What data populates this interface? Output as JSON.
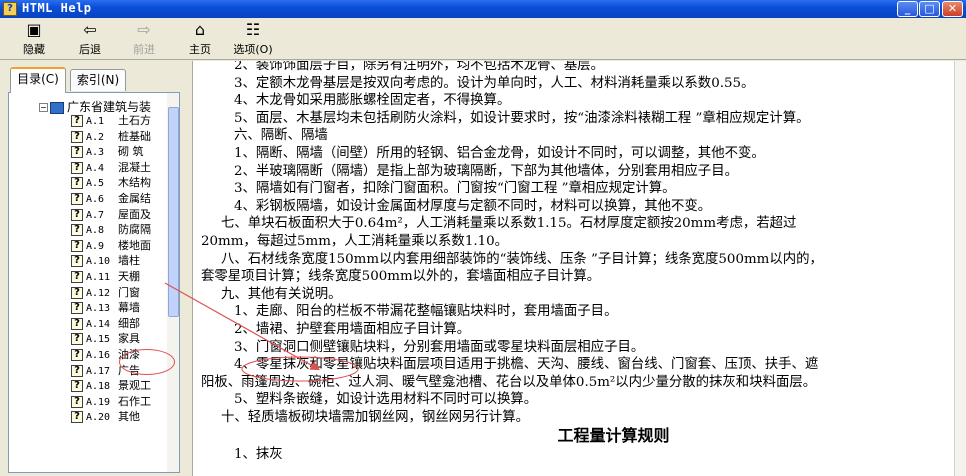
{
  "window": {
    "title": "HTML Help",
    "app_icon": "help-icon"
  },
  "toolbar": {
    "hide": {
      "label": "隐藏",
      "icon": "hide-icon"
    },
    "back": {
      "label": "后退",
      "icon": "back-arrow-icon"
    },
    "forward": {
      "label": "前进",
      "icon": "forward-arrow-icon"
    },
    "home": {
      "label": "主页",
      "icon": "home-icon"
    },
    "options": {
      "label": "选项(O)",
      "icon": "options-icon"
    }
  },
  "tabs": {
    "contents": "目录(C)",
    "index": "索引(N)"
  },
  "tree": {
    "root_label": "广东省建筑与装",
    "items": [
      {
        "code": "A.1",
        "name": "土石方"
      },
      {
        "code": "A.2",
        "name": "桩基础"
      },
      {
        "code": "A.3",
        "name": "砌  筑"
      },
      {
        "code": "A.4",
        "name": "混凝土"
      },
      {
        "code": "A.5",
        "name": "木结构"
      },
      {
        "code": "A.6",
        "name": "金属结"
      },
      {
        "code": "A.7",
        "name": "屋面及"
      },
      {
        "code": "A.8",
        "name": "防腐隔"
      },
      {
        "code": "A.9",
        "name": "楼地面"
      },
      {
        "code": "A.10",
        "name": "墙柱"
      },
      {
        "code": "A.11",
        "name": "天棚"
      },
      {
        "code": "A.12",
        "name": "门窗"
      },
      {
        "code": "A.13",
        "name": "幕墙"
      },
      {
        "code": "A.14",
        "name": "细部"
      },
      {
        "code": "A.15",
        "name": "家具"
      },
      {
        "code": "A.16",
        "name": "油漆"
      },
      {
        "code": "A.17",
        "name": "广告"
      },
      {
        "code": "A.18",
        "name": "景观工"
      },
      {
        "code": "A.19",
        "name": "石作工"
      },
      {
        "code": "A.20",
        "name": "其他"
      }
    ]
  },
  "content": {
    "lines": [
      {
        "indent": 1,
        "text": "2、装饰饰面层子目，除另有注明外，均不包括木龙骨、基层。"
      },
      {
        "indent": 1,
        "text": "3、定额木龙骨基层是按双向考虑的。设计为单向时，人工、材料消耗量乘以系数0.55。"
      },
      {
        "indent": 1,
        "text": "4、木龙骨如采用膨胀螺栓固定者，不得换算。"
      },
      {
        "indent": 1,
        "text": "5、面层、木基层均未包括刷防火涂料，如设计要求时，按“油漆涂料裱糊工程 ”章相应规定计算。"
      },
      {
        "indent": 1,
        "text": "六、隔断、隔墙"
      },
      {
        "indent": 1,
        "text": "1、隔断、隔墙（间壁）所用的轻钢、铝合金龙骨，如设计不同时，可以调整，其他不变。"
      },
      {
        "indent": 1,
        "text": "2、半玻璃隔断（隔墙）是指上部为玻璃隔断，下部为其他墙体，分别套用相应子目。"
      },
      {
        "indent": 1,
        "text": "3、隔墙如有门窗者，扣除门窗面积。门窗按“门窗工程 ”章相应规定计算。"
      },
      {
        "indent": 1,
        "text": "4、彩钢板隔墙，如设计金属面材厚度与定额不同时，材料可以换算，其他不变。"
      },
      {
        "indent": 2,
        "text": "七、单块石板面积大于0.64m²，人工消耗量乘以系数1.15。石材厚度定额按20mm考虑，若超过"
      },
      {
        "indent": 0,
        "text": "20mm，每超过5mm，人工消耗量乘以系数1.10。"
      },
      {
        "indent": 2,
        "text": "八、石材线条宽度150mm以内套用细部装饰的“装饰线、压条 ”子目计算；线条宽度500mm以内的，"
      },
      {
        "indent": 0,
        "text": "套零星项目计算；线条宽度500mm以外的，套墙面相应子目计算。"
      },
      {
        "indent": 2,
        "text": "九、其他有关说明。"
      },
      {
        "indent": 1,
        "text": "1、走廊、阳台的栏板不带漏花整幅镶贴块料时，套用墙面子目。"
      },
      {
        "indent": 1,
        "text": "2、墙裙、护壁套用墙面相应子目计算。"
      },
      {
        "indent": 1,
        "text": "3、门窗洞口侧壁镶贴块料，分别套用墙面或零星块料面层相应子目。"
      },
      {
        "indent": 1,
        "text": "4、零星抹灰和零星镶贴块料面层项目适用于挑檐、天沟、腰线、窗台线、门窗套、压顶、扶手、遮"
      },
      {
        "indent": 0,
        "text": "阳板、雨篷周边、碗柜、过人洞、暖气壁龛池槽、花台以及单体0.5m²以内少量分散的抹灰和块料面层。"
      },
      {
        "indent": 1,
        "text": "5、塑料条嵌缝，如设计选用材料不同时可以换算。"
      },
      {
        "indent": 2,
        "text": "十、轻质墙板砌块墙需加钢丝网，钢丝网另行计算。"
      }
    ],
    "section_title": "工程量计算规则",
    "cut_line": "1、抹灰"
  },
  "colors": {
    "titlebar": "#0a4fd8",
    "annotation": "#e05050",
    "selection": "#316ac5"
  }
}
